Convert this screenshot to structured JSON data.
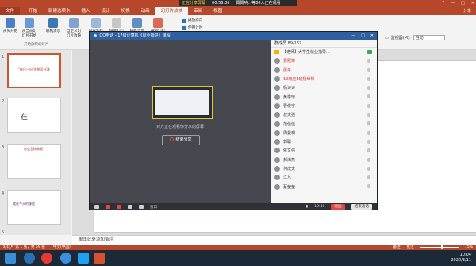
{
  "colors": {
    "brand": "#b7472a",
    "qq_blue": "#2f5f9e",
    "danger": "#e04848",
    "highlight": "#e8c32b"
  },
  "titlebar": {
    "sharing_status": "正在分享屏幕",
    "timer": "00:56:36",
    "viewers": "箐箐呐...等88人正在观看",
    "window_controls": [
      "?",
      "—",
      "□",
      "✕"
    ]
  },
  "ribbon": {
    "tabs": [
      "文件",
      "开始",
      "新建选项卡",
      "插入",
      "设计",
      "切换",
      "动画",
      "幻灯片放映",
      "审阅",
      "视图"
    ],
    "right_text": "分享",
    "buttons": [
      {
        "label": "从头开始"
      },
      {
        "label": "从当前幻灯片开始"
      },
      {
        "label": "联机演示"
      },
      {
        "label": "自定义幻灯片放映"
      },
      {
        "label": "设置幻灯片放映"
      },
      {
        "label": "隐藏幻灯片"
      },
      {
        "label": "排练计时"
      },
      {
        "label": "录制幻灯片演示"
      }
    ],
    "group_label": "开始放映幻灯片",
    "checkboxes": [
      {
        "label": "播放旁白",
        "checked": true
      },
      {
        "label": "使用计时",
        "checked": true
      },
      {
        "label": "显示媒体控件",
        "checked": true
      }
    ],
    "monitor_label": "监视器(M):",
    "monitor_value": "自动"
  },
  "slides": [
    {
      "num": "1",
      "caption": "\"每日一句\"系统设计课"
    },
    {
      "num": "2",
      "caption": "在"
    },
    {
      "num": "3",
      "caption": "你会怎样做呢？"
    },
    {
      "num": "4",
      "caption": "我在今天的课程"
    },
    {
      "num": "5",
      "caption": ""
    }
  ],
  "notes_placeholder": "单击此处添加备注",
  "statusbar": {
    "slide_info": "幻灯片 第 1 张，共 59 张",
    "language": "中文(中国)",
    "notes_btn": "备注",
    "comments_btn": "批注",
    "zoom": "75%"
  },
  "qq": {
    "title": "QQ电话 - 17级计算机《就业指导》课程",
    "screen_hint": "对方正在观看你分享的屏幕",
    "stop_button": "结束分享",
    "controls": {
      "time": "10:40",
      "exit": "退出",
      "end_call": "结束通话",
      "mute_label": "静音",
      "window_label": "窗口"
    },
    "members_header": "群成员 89/167",
    "members": [
      {
        "name": "【老师】大学生就业指导...",
        "color": "#333333",
        "role": "teacher"
      },
      {
        "name": "曹冠琳",
        "color": "#d62f2f",
        "role": "member"
      },
      {
        "name": "张平",
        "color": "#d62f2f",
        "role": "member"
      },
      {
        "name": "19级应2班杨世彬",
        "color": "#d62f2f",
        "role": "member"
      },
      {
        "name": "杨诗诗",
        "color": "#333333",
        "role": "member"
      },
      {
        "name": "黄学琼",
        "color": "#333333",
        "role": "member"
      },
      {
        "name": "曹俊宁",
        "color": "#333333",
        "role": "member"
      },
      {
        "name": "叔文强",
        "color": "#333333",
        "role": "member"
      },
      {
        "name": "范佳佳",
        "color": "#333333",
        "role": "member"
      },
      {
        "name": "周曼玥",
        "color": "#333333",
        "role": "member"
      },
      {
        "name": "郭聪",
        "color": "#333333",
        "role": "member"
      },
      {
        "name": "侯文强",
        "color": "#333333",
        "role": "member"
      },
      {
        "name": "郝海燕",
        "color": "#333333",
        "role": "member"
      },
      {
        "name": "何成文",
        "color": "#333333",
        "role": "member"
      },
      {
        "name": "江凡",
        "color": "#333333",
        "role": "member"
      },
      {
        "name": "蔡莹莹",
        "color": "#333333",
        "role": "member"
      }
    ]
  },
  "taskbar": {
    "clock": "10:04",
    "date": "2020/3/11",
    "apps": [
      "start-icon",
      "search-icon",
      "sogou-icon",
      "browser-icon",
      "qq-icon",
      "folder-icon",
      "powerpoint-icon"
    ]
  }
}
